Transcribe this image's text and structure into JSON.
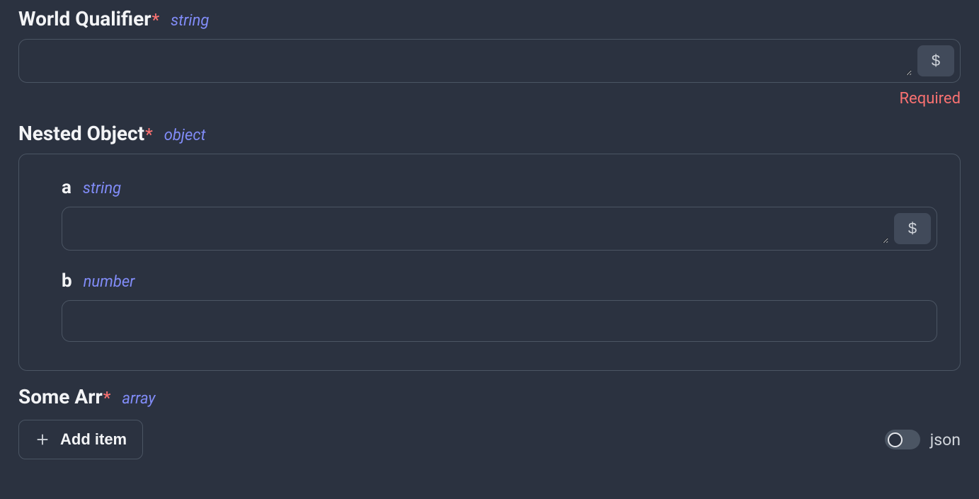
{
  "fields": {
    "worldQualifier": {
      "label": "World Qualifier",
      "type": "string",
      "required": true,
      "value": "",
      "error": "Required"
    },
    "nestedObject": {
      "label": "Nested Object",
      "type": "object",
      "required": true,
      "children": {
        "a": {
          "label": "a",
          "type": "string",
          "value": ""
        },
        "b": {
          "label": "b",
          "type": "number",
          "value": ""
        }
      }
    },
    "someArr": {
      "label": "Some Arr",
      "type": "array",
      "required": true,
      "addItemLabel": "Add item",
      "jsonToggleLabel": "json",
      "jsonToggleState": false
    }
  },
  "asterisk": "*",
  "dollarIcon": "$"
}
